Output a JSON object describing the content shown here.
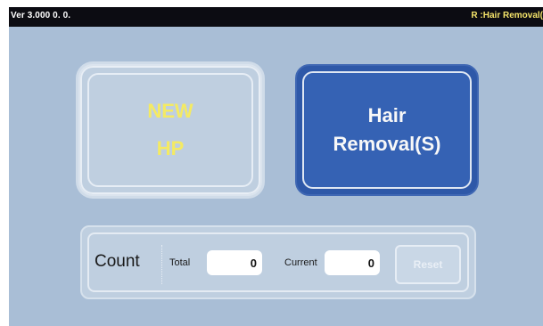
{
  "header": {
    "version": "Ver 3.000 0. 0.",
    "mode_status": "R :Hair Removal(S)"
  },
  "modes": {
    "new_hp": {
      "line1": "NEW",
      "line2": "HP",
      "state": "disabled"
    },
    "hair_removal": {
      "line1": "Hair",
      "line2": "Removal(S)",
      "state": "selected"
    }
  },
  "count": {
    "label": "Count",
    "total_label": "Total",
    "total_value": "0",
    "current_label": "Current",
    "current_value": "0",
    "reset_label": "Reset"
  },
  "colors": {
    "background": "#a9bed6",
    "topbar": "#0c0c12",
    "selected_button": "#2e58a8",
    "disabled_text": "#f4ea63"
  }
}
